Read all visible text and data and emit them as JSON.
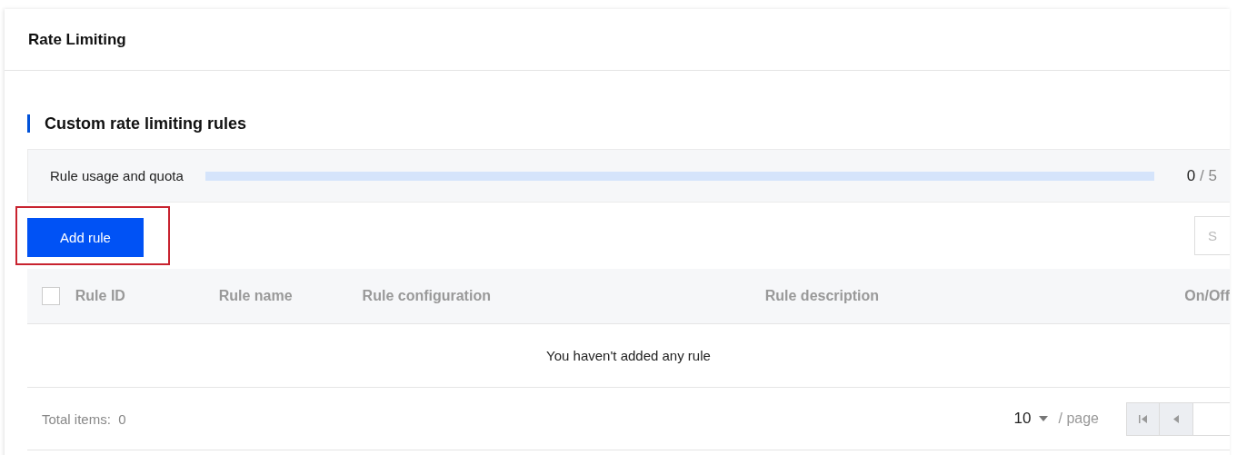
{
  "header": {
    "title": "Rate Limiting"
  },
  "section": {
    "title": "Custom rate limiting rules"
  },
  "quota": {
    "label": "Rule usage and quota",
    "level": 0,
    "used": "0",
    "limit": "/ 5"
  },
  "toolbar": {
    "add_button": "Add rule",
    "highlighted": true,
    "search": {
      "placeholder": "S"
    }
  },
  "table": {
    "select_all": {
      "checked": false
    },
    "columns": [
      {
        "label": "Rule ID"
      },
      {
        "label": "Rule name"
      },
      {
        "label": "Rule configuration"
      },
      {
        "label": "Rule description"
      },
      {
        "label": "On/Off"
      }
    ],
    "empty_text": "You haven't added any rule"
  },
  "footer": {
    "total": "Total items:  0",
    "page_size": "10",
    "per_page": "/ page",
    "first_disabled": true,
    "prev_disabled": true
  }
}
